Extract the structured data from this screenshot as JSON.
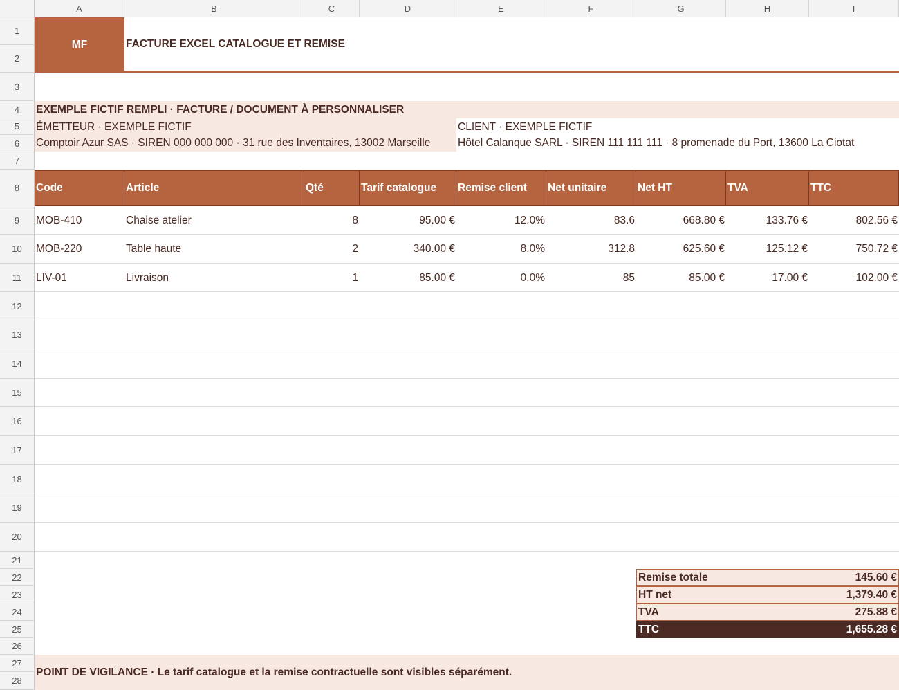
{
  "columns": [
    "A",
    "B",
    "C",
    "D",
    "E",
    "F",
    "G",
    "H",
    "I"
  ],
  "rows": [
    "1",
    "2",
    "3",
    "4",
    "5",
    "6",
    "7",
    "8",
    "9",
    "10",
    "11",
    "12",
    "13",
    "14",
    "15",
    "16",
    "17",
    "18",
    "19",
    "20",
    "21",
    "22",
    "23",
    "24",
    "25",
    "26",
    "27",
    "28"
  ],
  "logo": "MF",
  "title": "FACTURE EXCEL CATALOGUE ET REMISE",
  "banner": "EXEMPLE FICTIF REMPLI · FACTURE / DOCUMENT À PERSONNALISER",
  "emitter": {
    "label": "ÉMETTEUR · EXEMPLE FICTIF",
    "details": "Comptoir Azur SAS · SIREN 000 000 000 · 31 rue des Inventaires, 13002 Marseille"
  },
  "client": {
    "label": "CLIENT · EXEMPLE FICTIF",
    "details": "Hôtel Calanque SARL · SIREN 111 111 111 · 8 promenade du Port, 13600 La Ciotat"
  },
  "table": {
    "headers": [
      "Code",
      "Article",
      "Qté",
      "Tarif catalogue",
      "Remise client",
      "Net unitaire",
      "Net HT",
      "TVA",
      "TTC"
    ],
    "rows": [
      [
        "MOB-410",
        "Chaise atelier",
        "8",
        "95.00 €",
        "12.0%",
        "83.6",
        "668.80 €",
        "133.76 €",
        "802.56 €"
      ],
      [
        "MOB-220",
        "Table haute",
        "2",
        "340.00 €",
        "8.0%",
        "312.8",
        "625.60 €",
        "125.12 €",
        "750.72 €"
      ],
      [
        "LIV-01",
        "Livraison",
        "1",
        "85.00 €",
        "0.0%",
        "85",
        "85.00 €",
        "17.00 €",
        "102.00 €"
      ]
    ]
  },
  "totals": [
    {
      "label": "Remise totale",
      "value": "145.60 €"
    },
    {
      "label": "HT net",
      "value": "1,379.40 €"
    },
    {
      "label": "TVA",
      "value": "275.88 €"
    },
    {
      "label": "TTC",
      "value": "1,655.28 €"
    }
  ],
  "note": "POINT DE VIGILANCE · Le tarif catalogue et la remise contractuelle sont visibles séparément.",
  "colors": {
    "accent": "#b5643f",
    "accent_dark": "#7a3a22",
    "band": "#f8e8e2",
    "total_dark": "#4a2a22",
    "text": "#4a2a22"
  }
}
